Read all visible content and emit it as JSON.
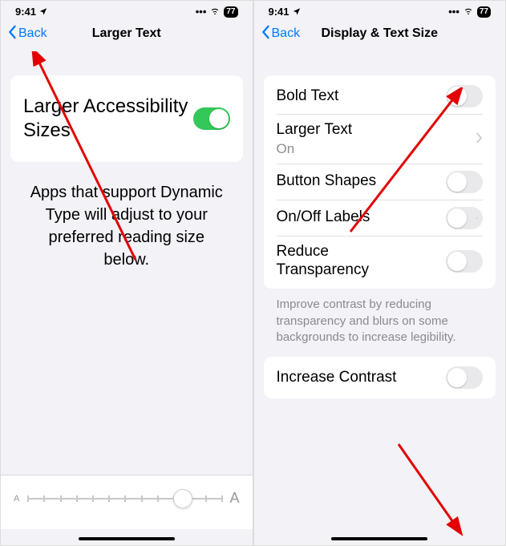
{
  "status": {
    "time": "9:41",
    "battery": "77"
  },
  "left": {
    "back": "Back",
    "title": "Larger Text",
    "card_label": "Larger Accessibility Sizes",
    "help": "Apps that support Dynamic Type will adjust to your preferred reading size below.",
    "slider_min": "A",
    "slider_max": "A"
  },
  "right": {
    "back": "Back",
    "title": "Display & Text Size",
    "rows": {
      "bold": "Bold Text",
      "larger": "Larger Text",
      "larger_state": "On",
      "shapes": "Button Shapes",
      "onoff": "On/Off Labels",
      "reduce": "Reduce Transparency",
      "contrast": "Increase Contrast"
    },
    "footer": "Improve contrast by reducing transparency and blurs on some backgrounds to increase legibility."
  }
}
